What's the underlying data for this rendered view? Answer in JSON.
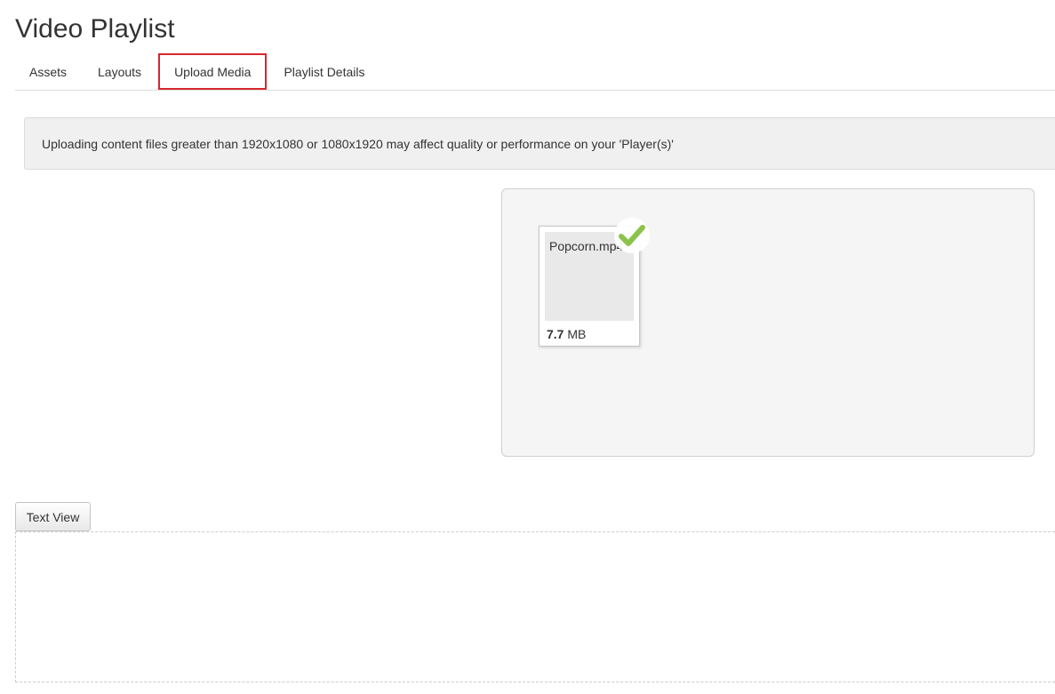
{
  "page": {
    "title": "Video Playlist"
  },
  "tabs": [
    {
      "label": "Assets",
      "active": false
    },
    {
      "label": "Layouts",
      "active": false
    },
    {
      "label": "Upload Media",
      "active": true
    },
    {
      "label": "Playlist Details",
      "active": false
    }
  ],
  "notice": {
    "text": "Uploading content files greater than 1920x1080 or 1080x1920 may affect quality or performance on your 'Player(s)'"
  },
  "upload": {
    "file": {
      "name": "Popcorn.mp4",
      "size_value": "7.7",
      "size_unit": " MB",
      "status_icon": "checkmark-icon"
    }
  },
  "editor": {
    "text_view_label": "Text View"
  },
  "colors": {
    "active_tab_border": "#d9262c",
    "success_check": "#8bc34a"
  }
}
